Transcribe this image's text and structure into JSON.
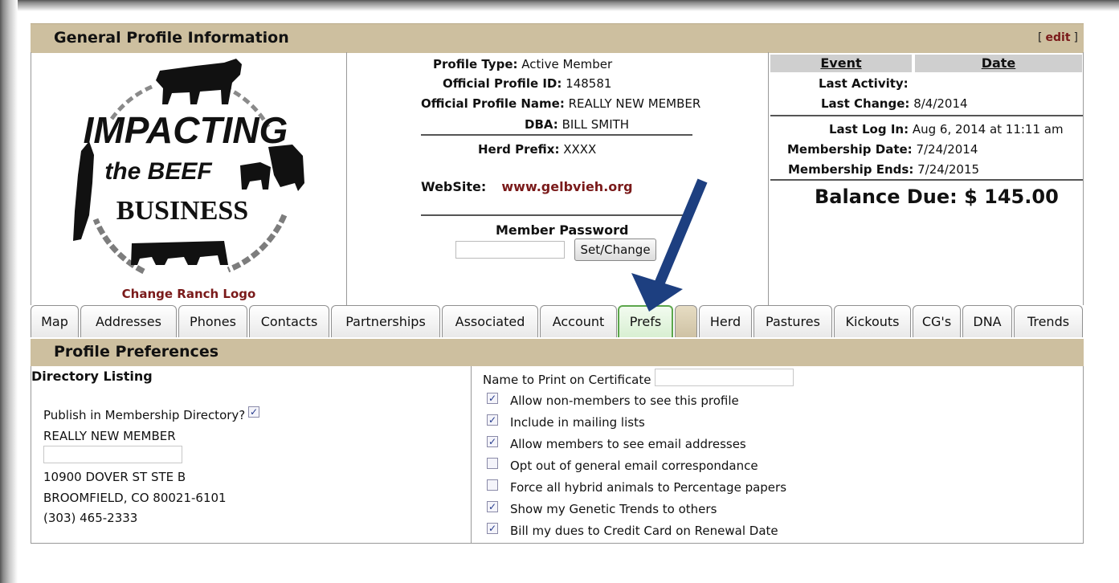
{
  "header": {
    "title": "General Profile Information",
    "edit_label": "edit",
    "bracket_open": "[",
    "bracket_close": "]"
  },
  "logo": {
    "line1": "IMPACTING",
    "line2": "the BEEF",
    "line3": "BUSINESS",
    "change_label": "Change Ranch Logo"
  },
  "profile": {
    "type_label": "Profile Type:",
    "type": "Active Member",
    "id_label": "Official Profile ID:",
    "id": "148581",
    "name_label": "Official Profile Name:",
    "name": "REALLY NEW MEMBER",
    "dba_label": "DBA:",
    "dba": "BILL SMITH",
    "herd_prefix_label": "Herd Prefix:",
    "herd_prefix": "XXXX",
    "website_label": "WebSite:",
    "website": "www.gelbvieh.org",
    "password_label": "Member Password",
    "password_button": "Set/Change"
  },
  "events": {
    "event_header": "Event",
    "date_header": "Date",
    "last_activity_label": "Last Activity:",
    "last_activity": "",
    "last_change_label": "Last Change:",
    "last_change": "8/4/2014",
    "last_login_label": "Last Log In:",
    "last_login": "Aug 6, 2014 at 11:11 am",
    "membership_date_label": "Membership Date:",
    "membership_date": "7/24/2014",
    "membership_ends_label": "Membership Ends:",
    "membership_ends": "7/24/2015",
    "balance": "Balance Due: $ 145.00"
  },
  "tabs": [
    "Map",
    "Addresses",
    "Phones",
    "Contacts",
    "Partnerships",
    "Associated",
    "Account",
    "Prefs",
    "",
    "Herd",
    "Pastures",
    "Kickouts",
    "CG's",
    "DNA",
    "Trends"
  ],
  "preferences": {
    "title": "Profile Preferences",
    "directory_title": "Directory Listing",
    "publish_label": "Publish in Membership Directory?",
    "publish_checked": true,
    "name": "REALLY NEW MEMBER",
    "address1": "10900 DOVER ST STE B",
    "address2": "BROOMFIELD, CO 80021-6101",
    "phone": "(303) 465-2333",
    "cert_label": "Name to Print on Certificate",
    "options": [
      {
        "label": "Allow non-members to see this profile",
        "checked": true
      },
      {
        "label": "Include in mailing lists",
        "checked": true
      },
      {
        "label": "Allow members to see email addresses",
        "checked": true
      },
      {
        "label": "Opt out of general email correspondance",
        "checked": false
      },
      {
        "label": "Force all hybrid animals to Percentage papers",
        "checked": false
      },
      {
        "label": "Show my Genetic Trends to others",
        "checked": true
      },
      {
        "label": "Bill my dues to Credit Card on Renewal Date",
        "checked": true
      }
    ]
  },
  "colors": {
    "header_bg": "#cdbf9f",
    "link": "#7a1a1a",
    "arrow": "#1d3f80",
    "active_tab_border": "#5ca64c"
  },
  "icons": {
    "arrow": "down-left-arrow-icon",
    "checkbox": "checkbox-icon"
  }
}
